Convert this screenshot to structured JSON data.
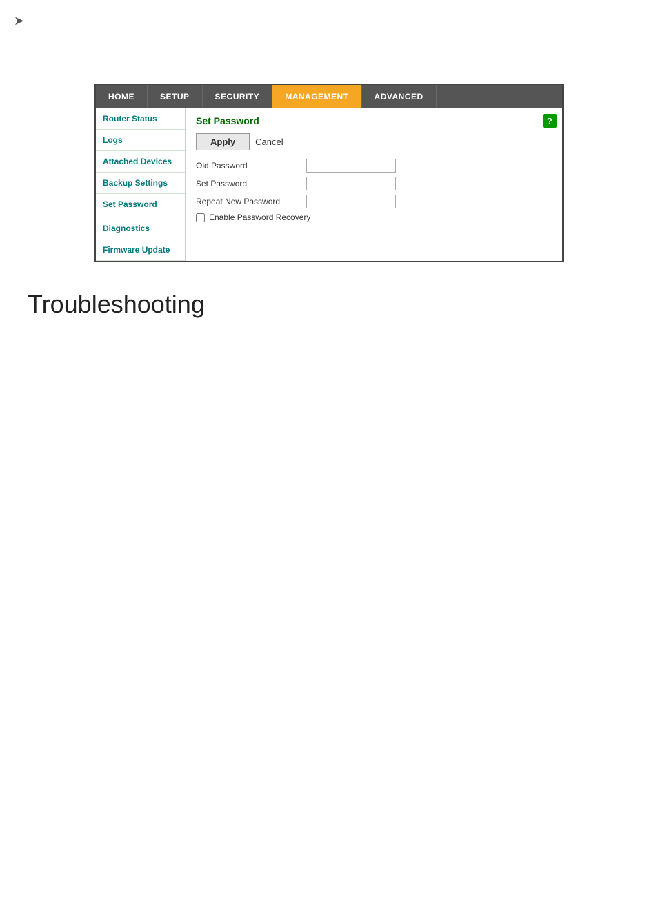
{
  "nav": {
    "items": [
      {
        "id": "home",
        "label": "HOME",
        "active": false
      },
      {
        "id": "setup",
        "label": "SETUP",
        "active": false
      },
      {
        "id": "security",
        "label": "SECURITY",
        "active": false
      },
      {
        "id": "management",
        "label": "MANAGEMENT",
        "active": true
      },
      {
        "id": "advanced",
        "label": "ADVANCED",
        "active": false
      }
    ]
  },
  "sidebar": {
    "items": [
      {
        "id": "router-status",
        "label": "Router Status"
      },
      {
        "id": "logs",
        "label": "Logs"
      },
      {
        "id": "attached-devices",
        "label": "Attached Devices"
      },
      {
        "id": "backup-settings",
        "label": "Backup Settings"
      },
      {
        "id": "set-password",
        "label": "Set Password"
      },
      {
        "id": "diagnostics",
        "label": "Diagnostics"
      },
      {
        "id": "firmware-update",
        "label": "Firmware Update"
      }
    ]
  },
  "content": {
    "title": "Set Password",
    "apply_label": "Apply",
    "cancel_label": "Cancel",
    "help_icon": "?",
    "fields": [
      {
        "id": "old-password",
        "label": "Old Password"
      },
      {
        "id": "set-password",
        "label": "Set Password"
      },
      {
        "id": "repeat-password",
        "label": "Repeat New Password"
      }
    ],
    "checkbox_label": "Enable Password Recovery"
  },
  "troubleshooting": {
    "heading": "Troubleshooting"
  },
  "arrow_icon": "➤"
}
